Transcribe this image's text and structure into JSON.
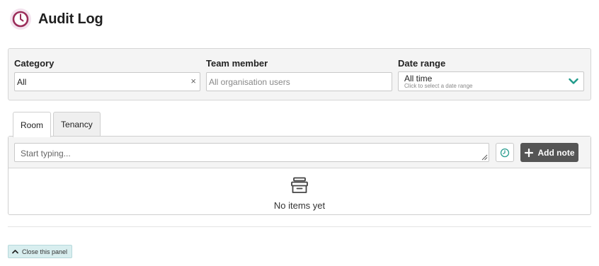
{
  "header": {
    "title": "Audit Log",
    "icon": "clock-icon",
    "accent": "#9b2d5a"
  },
  "filters": {
    "category": {
      "label": "Category",
      "value": "All",
      "clear_glyph": "×"
    },
    "team_member": {
      "label": "Team member",
      "placeholder": "All organisation users"
    },
    "date_range": {
      "label": "Date range",
      "value": "All time",
      "hint": "Click to select a date range"
    }
  },
  "tabs": [
    {
      "label": "Room",
      "active": true
    },
    {
      "label": "Tenancy",
      "active": false
    }
  ],
  "compose": {
    "placeholder": "Start typing...",
    "add_label": "Add note",
    "add_color": "#555555",
    "clock_color": "#2a9d8f"
  },
  "empty": {
    "text": "No items yet",
    "icon": "archive-box-icon"
  },
  "footer": {
    "close_label": "Close this panel",
    "bg_color": "#d8eeef"
  }
}
